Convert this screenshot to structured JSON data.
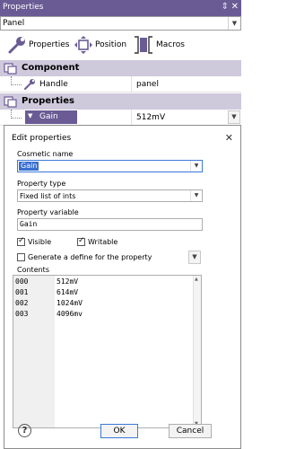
{
  "window": {
    "title": "Properties",
    "pin_glyph": "⇕",
    "close_glyph": "✕"
  },
  "object_selector": {
    "value": "Panel"
  },
  "toolbar": {
    "properties_label": "Properties",
    "position_label": "Position",
    "macros_label": "Macros"
  },
  "groups": [
    {
      "label": "Component",
      "icon": "component-icon"
    },
    {
      "label": "Properties",
      "icon": "properties-group-icon"
    }
  ],
  "rows": {
    "handle": {
      "name": "Handle",
      "value": "panel"
    },
    "gain": {
      "name": "Gain",
      "value": "512mV"
    }
  },
  "dialog": {
    "title": "Edit properties",
    "cosmetic_name_label": "Cosmetic name",
    "cosmetic_name_value": "Gain",
    "property_type_label": "Property type",
    "property_type_value": "Fixed list of ints",
    "property_variable_label": "Property variable",
    "property_variable_value": "Gain",
    "visible_label": "Visible",
    "visible_checked": true,
    "writable_label": "Writable",
    "writable_checked": true,
    "define_label": "Generate a define for the property",
    "define_checked": false,
    "contents_label": "Contents",
    "contents": [
      {
        "code": "000",
        "text": "512mV"
      },
      {
        "code": "001",
        "text": "614mV"
      },
      {
        "code": "002",
        "text": "1024mV"
      },
      {
        "code": "003",
        "text": "4096mv"
      }
    ],
    "ok_label": "OK",
    "cancel_label": "Cancel",
    "help_glyph": "?"
  },
  "colors": {
    "titlebar": "#6a5b95",
    "group_header": "#cfc9dc",
    "selection": "#6a5b95",
    "focus": "#3c78d8"
  }
}
